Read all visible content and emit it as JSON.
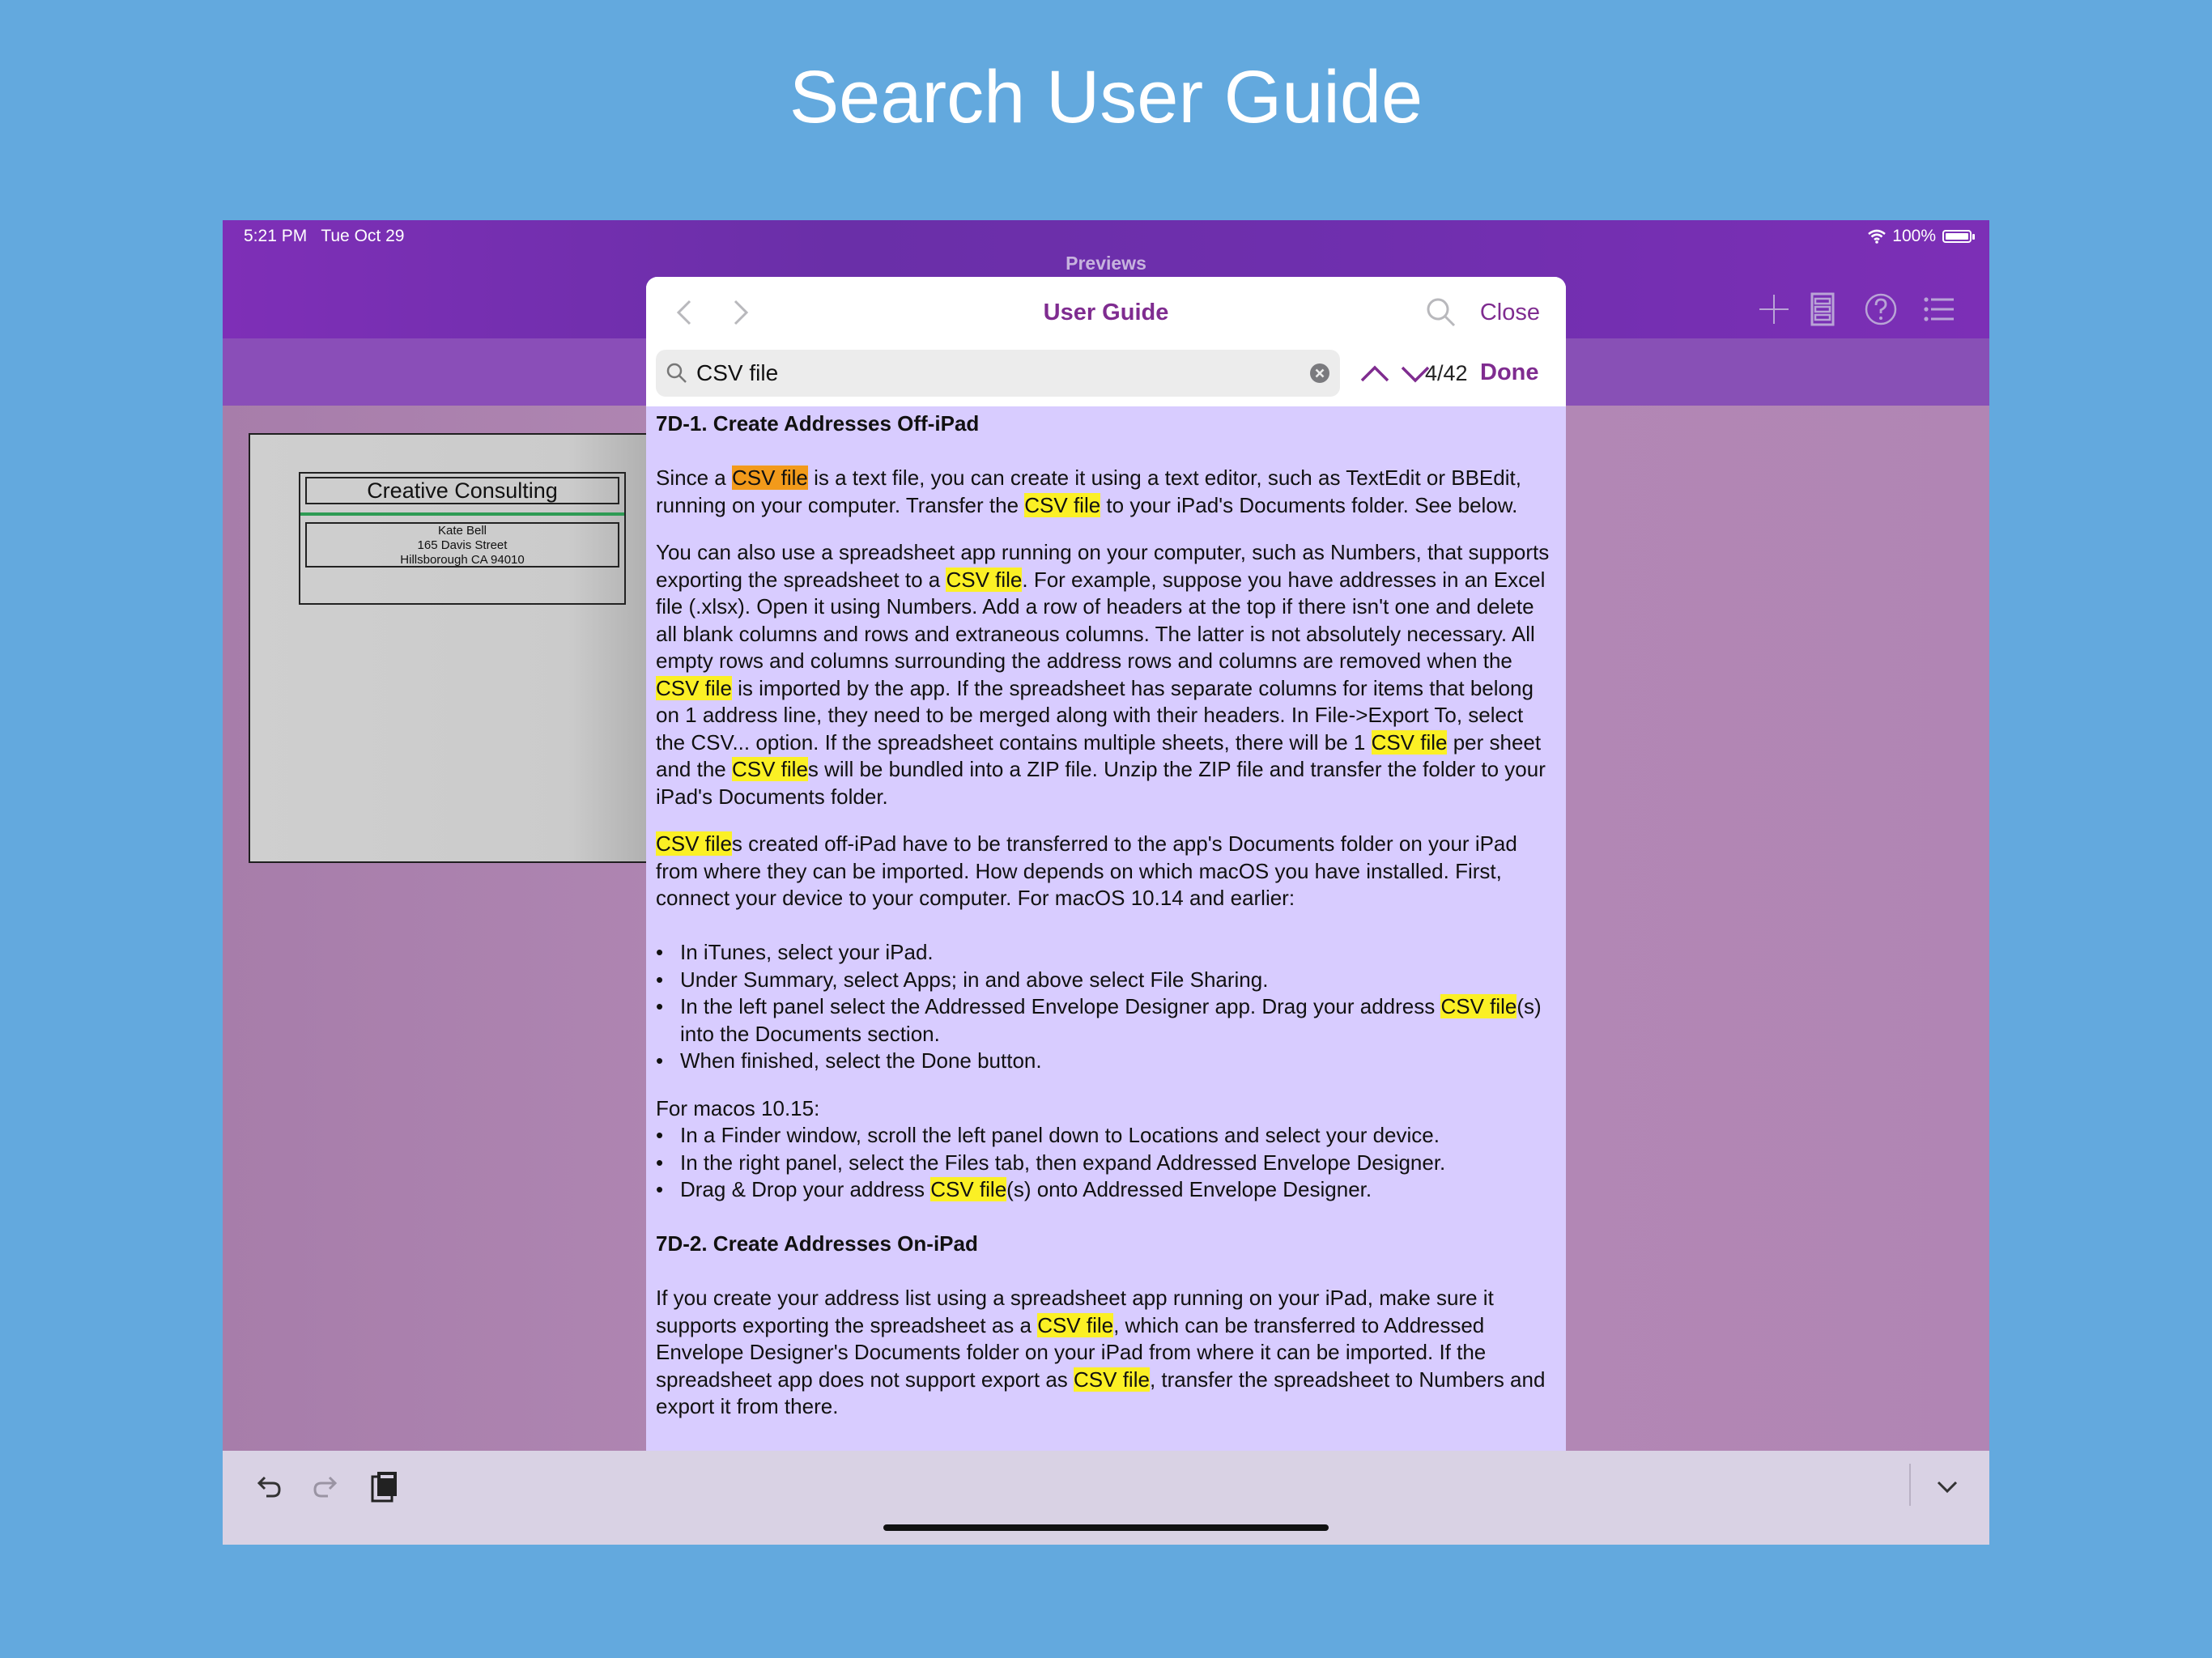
{
  "headline": "Search User Guide",
  "status": {
    "time": "5:21 PM   Tue Oct 29",
    "battery": "100%"
  },
  "app": {
    "title": "Previews"
  },
  "envelope": {
    "company": "Creative Consulting",
    "name": "Kate Bell",
    "street": "165 Davis Street",
    "city": "Hillsborough CA 94010"
  },
  "guide": {
    "title": "User Guide",
    "close_label": "Close",
    "search": {
      "value": "CSV file",
      "placeholder": "Search",
      "count": "4/42",
      "done_label": "Done"
    },
    "s1_heading": "7D-1. Create Addresses Off-iPad",
    "p1": {
      "a": "Since a ",
      "m1": "CSV file",
      "b": " is a text file, you can create it using a text editor, such as TextEdit or BBEdit, running on your computer. Transfer the ",
      "m2": "CSV file",
      "c": " to your iPad's Documents folder. See below."
    },
    "p2": {
      "a": "You can also use a spreadsheet app running on your computer, such as Numbers, that supports exporting the spreadsheet to a ",
      "m1": "CSV file",
      "b": ". For example, suppose you have addresses in an Excel file (.xlsx). Open it using Numbers. Add a row of headers at the top if there isn't one and delete all blank columns and rows and extraneous columns. The latter is not absolutely necessary.  All empty rows and columns surrounding the address rows and columns are removed when the ",
      "m2": "CSV file",
      "c": " is imported by the app. If the spreadsheet has separate columns for items that belong on 1 address line, they need to be merged along with their headers. In File->Export To, select the CSV... option. If the spreadsheet contains multiple sheets, there will be 1 ",
      "m3": "CSV file",
      "d": " per sheet and the ",
      "m4": "CSV file",
      "e": "s will be bundled into a ZIP file. Unzip the ZIP file and transfer the folder to your iPad's Documents folder."
    },
    "p3": {
      "m1": "CSV file",
      "a": "s created off-iPad have to be transferred to the app's Documents folder on your iPad from where they can be imported. How depends on which macOS you have installed. First, connect your device to your computer. For macOS 10.14 and earlier:"
    },
    "list1": {
      "i1": "In iTunes, select your iPad.",
      "i2": "Under Summary, select Apps; in and above select File Sharing.",
      "i3a": "In the left panel select the Addressed Envelope Designer app. Drag your address ",
      "i3m": "CSV file",
      "i3b": "(s) into the Documents section.",
      "i4": "When finished, select the Done button."
    },
    "p4": "For macos 10.15:",
    "list2": {
      "i1": "In a Finder window, scroll the left panel down to Locations and select your device.",
      "i2": "In the right panel, select the Files tab, then expand Addressed Envelope Designer.",
      "i3a": "Drag & Drop your address ",
      "i3m": "CSV file",
      "i3b": "(s) onto Addressed Envelope Designer."
    },
    "s2_heading": "7D-2. Create Addresses On-iPad",
    "p5": {
      "a": "If you create your address list using a spreadsheet app running on your iPad, make sure it supports exporting the spreadsheet as a ",
      "m1": "CSV file",
      "b": ", which can be transferred to Addressed Envelope Designer's Documents folder on your iPad from where it can be imported. If the spreadsheet app does not support export as ",
      "m2": "CSV file",
      "c": ", transfer the spreadsheet to Numbers and export it from there."
    }
  },
  "colors": {
    "accent": "#7f2c90",
    "highlight": "#fbf025",
    "current_match": "#f29a1b",
    "panel_bg": "#d8ccff",
    "page_bg": "#63a9de"
  }
}
